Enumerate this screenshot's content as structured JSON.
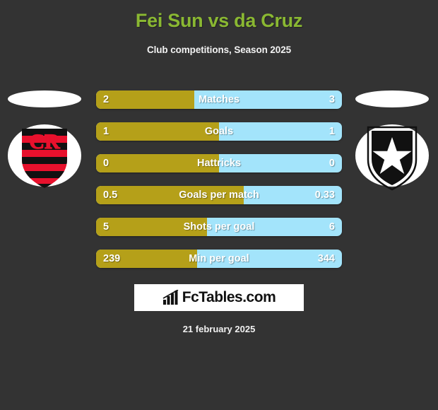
{
  "header": {
    "title": "Fei Sun vs da Cruz",
    "subtitle": "Club competitions, Season 2025"
  },
  "colors": {
    "background": "#333333",
    "title": "#8ab832",
    "home_bar": "#b5a019",
    "away_bar": "#a3e4fb",
    "text": "#ffffff"
  },
  "teams": {
    "home": {
      "crest": "flamengo-crest"
    },
    "away": {
      "crest": "botafogo-crest"
    }
  },
  "stats": [
    {
      "label": "Matches",
      "home": "2",
      "away": "3",
      "home_pct": 40
    },
    {
      "label": "Goals",
      "home": "1",
      "away": "1",
      "home_pct": 50
    },
    {
      "label": "Hattricks",
      "home": "0",
      "away": "0",
      "home_pct": 50
    },
    {
      "label": "Goals per match",
      "home": "0.5",
      "away": "0.33",
      "home_pct": 60
    },
    {
      "label": "Shots per goal",
      "home": "5",
      "away": "6",
      "home_pct": 45
    },
    {
      "label": "Min per goal",
      "home": "239",
      "away": "344",
      "home_pct": 41
    }
  ],
  "footer": {
    "logo_text": "FcTables.com",
    "logo_icon": "bar-chart-icon",
    "date": "21 february 2025"
  }
}
